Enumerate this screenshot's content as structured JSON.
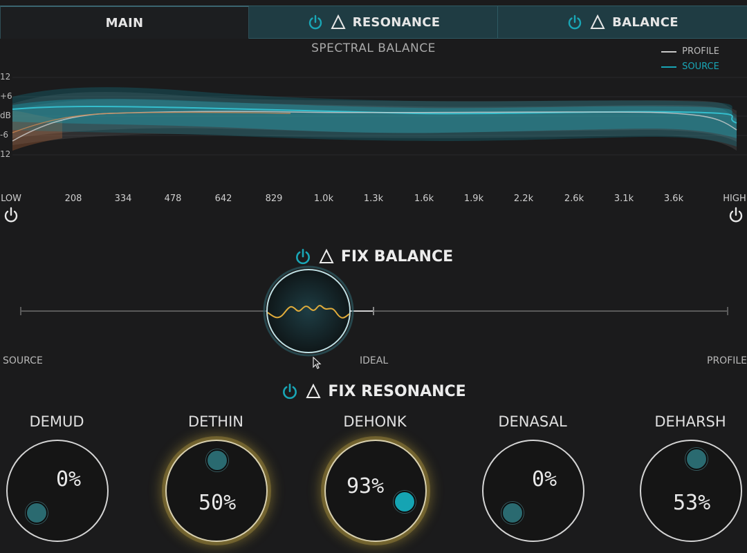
{
  "tabs": {
    "main": "MAIN",
    "resonance": "RESONANCE",
    "balance": "BALANCE"
  },
  "spectrum": {
    "title": "SPECTRAL BALANCE",
    "legend": [
      {
        "label": "PROFILE",
        "color": "#c8c8c8"
      },
      {
        "label": "SOURCE",
        "color": "#19a6b6"
      }
    ],
    "db_labels": [
      "12",
      "+6",
      "dB",
      "-6",
      "12"
    ],
    "freq_labels": [
      "LOW",
      "208",
      "334",
      "478",
      "642",
      "829",
      "1.0k",
      "1.3k",
      "1.6k",
      "1.9k",
      "2.2k",
      "2.6k",
      "3.1k",
      "3.6k",
      "HIGH"
    ]
  },
  "fix_balance": {
    "title": "FIX BALANCE",
    "left_label": "SOURCE",
    "mid_label": "IDEAL",
    "right_label": "PROFILE"
  },
  "fix_resonance": {
    "title": "FIX RESONANCE",
    "knobs": [
      {
        "label": "DEMUD",
        "value": "0%",
        "level": 0.0
      },
      {
        "label": "DETHIN",
        "value": "50%",
        "level": 0.5
      },
      {
        "label": "DEHONK",
        "value": "93%",
        "level": 0.93
      },
      {
        "label": "DENASAL",
        "value": "0%",
        "level": 0.0
      },
      {
        "label": "DEHARSH",
        "value": "53%",
        "level": 0.53
      }
    ]
  },
  "colors": {
    "accent": "#19a6b6",
    "glow": "#d2b24a",
    "background": "#1b1b1c"
  }
}
